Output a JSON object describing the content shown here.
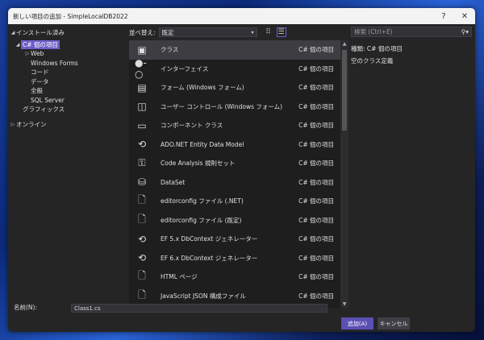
{
  "title": "新しい項目の追加 - SimpleLocalDB2022",
  "title_buttons": {
    "help": "?",
    "close": "✕"
  },
  "tree": {
    "installed": "インストール済み",
    "csharp": "C# 個の項目",
    "children": [
      "Web",
      "Windows Forms",
      "コード",
      "データ",
      "全般",
      "SQL Server"
    ],
    "graphics": "グラフィックス",
    "online": "オンライン"
  },
  "toolbar": {
    "sort_label": "並べ替え:",
    "sort_value": "既定"
  },
  "search": {
    "placeholder": "検索 (Ctrl+E)"
  },
  "items": [
    {
      "name": "クラス",
      "category": "C# 個の項目",
      "icon": "class-icon",
      "glyph": "▣"
    },
    {
      "name": "インターフェイス",
      "category": "C# 個の項目",
      "icon": "interface-icon",
      "glyph": "●-○"
    },
    {
      "name": "フォーム (Windows フォーム)",
      "category": "C# 個の項目",
      "icon": "form-icon",
      "glyph": "▤"
    },
    {
      "name": "ユーザー コントロール (Windows フォーム)",
      "category": "C# 個の項目",
      "icon": "user-control-icon",
      "glyph": "◫"
    },
    {
      "name": "コンポーネント クラス",
      "category": "C# 個の項目",
      "icon": "component-icon",
      "glyph": "▭"
    },
    {
      "name": "ADO.NET Entity Data Model",
      "category": "C# 個の項目",
      "icon": "entity-model-icon",
      "glyph": "⟲"
    },
    {
      "name": "Code Analysis 規則セット",
      "category": "C# 個の項目",
      "icon": "ruleset-icon",
      "glyph": "⚿"
    },
    {
      "name": "DataSet",
      "category": "C# 個の項目",
      "icon": "dataset-icon",
      "glyph": "⛁"
    },
    {
      "name": "editorconfig ファイル (.NET)",
      "category": "C# 個の項目",
      "icon": "editorconfig-icon",
      "glyph": "🗋"
    },
    {
      "name": "editorconfig ファイル (既定)",
      "category": "C# 個の項目",
      "icon": "editorconfig-icon",
      "glyph": "🗋"
    },
    {
      "name": "EF 5.x DbContext ジェネレーター",
      "category": "C# 個の項目",
      "icon": "ef-generator-icon",
      "glyph": "⟲"
    },
    {
      "name": "EF 6.x DbContext ジェネレーター",
      "category": "C# 個の項目",
      "icon": "ef-generator-icon",
      "glyph": "⟲"
    },
    {
      "name": "HTML ページ",
      "category": "C# 個の項目",
      "icon": "html-page-icon",
      "glyph": "🗋"
    },
    {
      "name": "JavaScript JSON 構成ファイル",
      "category": "C# 個の項目",
      "icon": "json-config-icon",
      "glyph": "🗋"
    }
  ],
  "details": {
    "type_label": "種類:",
    "type_value": "C# 個の項目",
    "description": "空のクラス定義"
  },
  "name_field": {
    "label": "名前(N):",
    "value": "Class1.cs"
  },
  "buttons": {
    "add": "追加(A)",
    "cancel": "キャンセル"
  }
}
